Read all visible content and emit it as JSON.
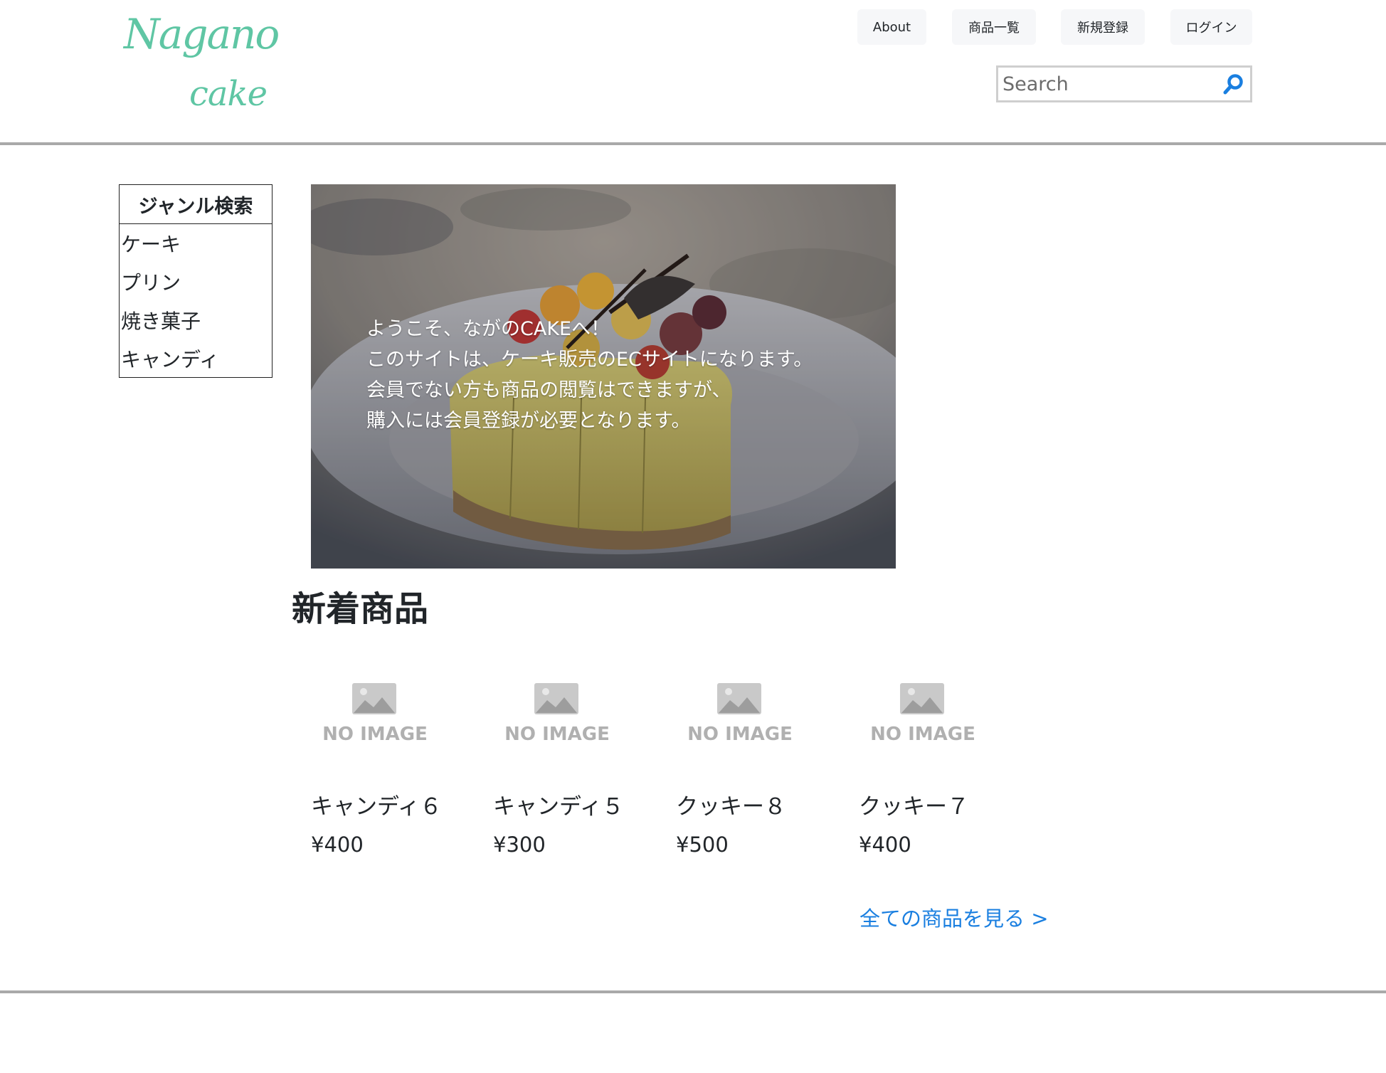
{
  "header": {
    "logo_line1": "Nagano",
    "logo_line2": "cake",
    "nav": [
      {
        "label": "About"
      },
      {
        "label": "商品一覧"
      },
      {
        "label": "新規登録"
      },
      {
        "label": "ログイン"
      }
    ],
    "search": {
      "placeholder": "Search",
      "value": ""
    }
  },
  "sidebar": {
    "title": "ジャンル検索",
    "genres": [
      {
        "label": "ケーキ"
      },
      {
        "label": "プリン"
      },
      {
        "label": "焼き菓子"
      },
      {
        "label": "キャンディ"
      }
    ]
  },
  "hero": {
    "lines": [
      "ようこそ、ながのCAKEへ！",
      "このサイトは、ケーキ販売のECサイトになります。",
      "会員でない方も商品の閲覧はできますが、",
      "購入には会員登録が必要となります。"
    ]
  },
  "new_items": {
    "title": "新着商品",
    "image_placeholder": "NO IMAGE",
    "items": [
      {
        "name": "キャンディ６",
        "price": "¥400"
      },
      {
        "name": "キャンディ５",
        "price": "¥300"
      },
      {
        "name": "クッキー８",
        "price": "¥500"
      },
      {
        "name": "クッキー７",
        "price": "¥400"
      }
    ],
    "see_all": "全ての商品を見る >"
  },
  "colors": {
    "brand": "#5fc6a4",
    "link": "#1a7fe0",
    "rule": "#a9a9a9"
  }
}
